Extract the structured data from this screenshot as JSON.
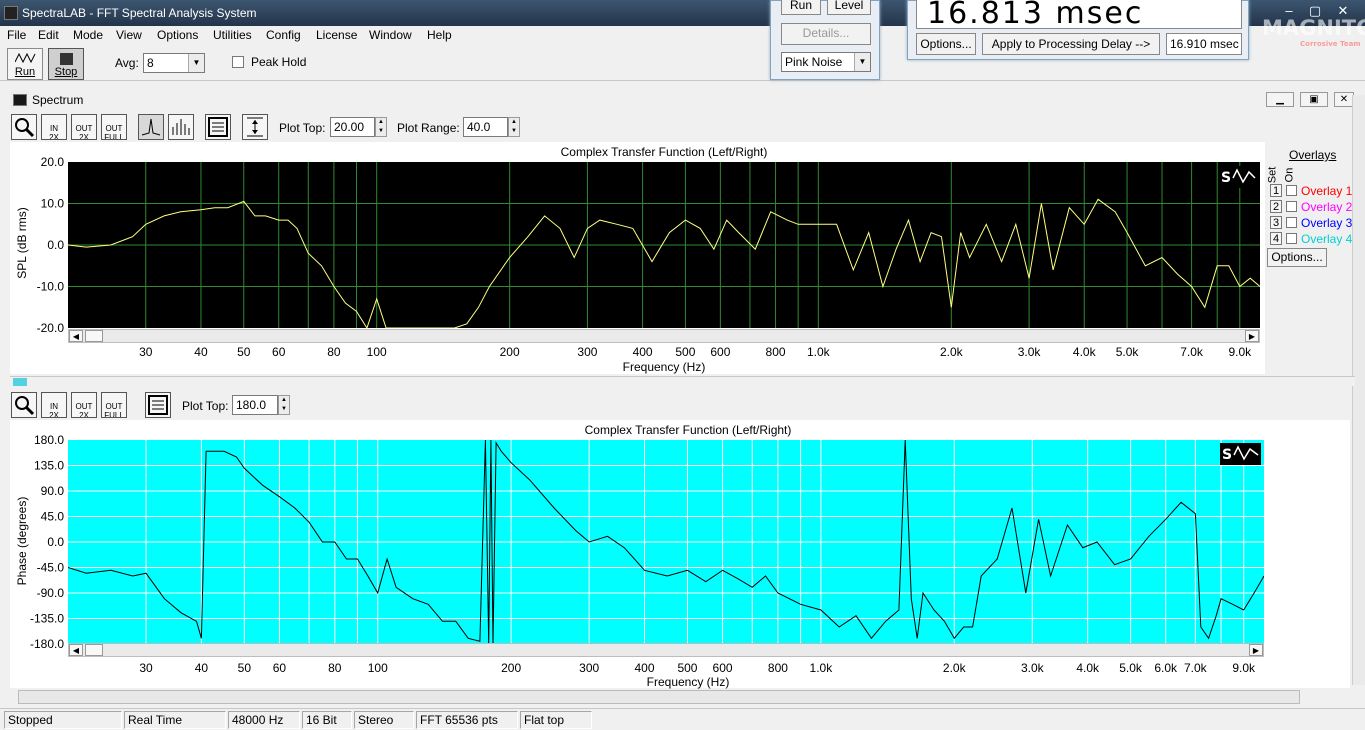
{
  "window": {
    "title": "SpectraLAB - FFT Spectral Analysis System"
  },
  "menu": [
    "File",
    "Edit",
    "Mode",
    "View",
    "Options",
    "Utilities",
    "Config",
    "License",
    "Window",
    "Help"
  ],
  "toolbar": {
    "run_label": "Run",
    "stop_label": "Stop",
    "avg_label": "Avg:",
    "avg_value": "8",
    "peak_hold_label": "Peak Hold"
  },
  "generator_panel": {
    "run_label": "Run",
    "level_label": "Level",
    "details_label": "Details...",
    "signal_value": "Pink Noise"
  },
  "delay_panel": {
    "delay_display": "16.813 msec",
    "options_label": "Options...",
    "apply_label": "Apply to Processing Delay -->",
    "delay_value": "16.910 msec"
  },
  "logo": {
    "main": "MAGNITOLA",
    "sub": "Corrosive Team"
  },
  "spectrum": {
    "window_title": "Spectrum",
    "plot_top_label": "Plot Top:",
    "plot_top_value": "20.00",
    "plot_range_label": "Plot Range:",
    "plot_range_value": "40.0",
    "overlays_title": "Overlays",
    "set_label": "Set",
    "on_label": "On",
    "overlays": [
      {
        "num": "1",
        "label": "Overlay 1",
        "color": "#ff0000"
      },
      {
        "num": "2",
        "label": "Overlay 2",
        "color": "#ff00ff"
      },
      {
        "num": "3",
        "label": "Overlay 3",
        "color": "#0000ff"
      },
      {
        "num": "4",
        "label": "Overlay 4",
        "color": "#00e0e0"
      }
    ],
    "options_label": "Options..."
  },
  "phase": {
    "plot_top_label": "Plot Top:",
    "plot_top_value": "180.0"
  },
  "status": [
    "Stopped",
    "Real Time",
    "48000 Hz",
    "16 Bit",
    "Stereo",
    "FFT 65536 pts",
    "Flat top"
  ],
  "chart_data": [
    {
      "type": "line",
      "title": "Complex Transfer Function (Left/Right)",
      "xlabel": "Frequency (Hz)",
      "ylabel": "SPL (dB rms)",
      "xscale": "log",
      "xlim": [
        20,
        10000
      ],
      "ylim": [
        -20,
        20
      ],
      "yticks": [
        "20.0",
        "10.0",
        "0.0",
        "-10.0",
        "-20.0"
      ],
      "xticks": [
        {
          "v": 30,
          "label": "30"
        },
        {
          "v": 40,
          "label": "40"
        },
        {
          "v": 50,
          "label": "50"
        },
        {
          "v": 60,
          "label": "60"
        },
        {
          "v": 80,
          "label": "80"
        },
        {
          "v": 100,
          "label": "100"
        },
        {
          "v": 200,
          "label": "200"
        },
        {
          "v": 300,
          "label": "300"
        },
        {
          "v": 400,
          "label": "400"
        },
        {
          "v": 500,
          "label": "500"
        },
        {
          "v": 600,
          "label": "600"
        },
        {
          "v": 800,
          "label": "800"
        },
        {
          "v": 1000,
          "label": "1.0k"
        },
        {
          "v": 2000,
          "label": "2.0k"
        },
        {
          "v": 3000,
          "label": "3.0k"
        },
        {
          "v": 4000,
          "label": "4.0k"
        },
        {
          "v": 5000,
          "label": "5.0k"
        },
        {
          "v": 7000,
          "label": "7.0k"
        },
        {
          "v": 9000,
          "label": "9.0k"
        }
      ],
      "background": "#000000",
      "grid_color": "#2e8b2e",
      "line_color": "#ffff80",
      "x": [
        20,
        22,
        25,
        28,
        30,
        33,
        36,
        40,
        43,
        46,
        50,
        53,
        56,
        60,
        63,
        66,
        70,
        75,
        80,
        85,
        90,
        95,
        100,
        105,
        110,
        120,
        130,
        140,
        150,
        160,
        170,
        180,
        200,
        220,
        240,
        260,
        280,
        300,
        320,
        350,
        380,
        420,
        460,
        500,
        540,
        580,
        620,
        660,
        720,
        780,
        850,
        900,
        1000,
        1100,
        1200,
        1300,
        1400,
        1500,
        1600,
        1700,
        1800,
        1900,
        2000,
        2100,
        2200,
        2400,
        2600,
        2800,
        3000,
        3200,
        3400,
        3700,
        4000,
        4300,
        4700,
        5000,
        5500,
        6000,
        6500,
        7000,
        7500,
        8000,
        8500,
        9000,
        9500,
        10000
      ],
      "y": [
        0,
        -0.5,
        0,
        2,
        5,
        7,
        8,
        8.5,
        9,
        9,
        10.5,
        7,
        7,
        6,
        6,
        4,
        -2,
        -5,
        -10,
        -14,
        -16,
        -20,
        -13,
        -20,
        -20,
        -20,
        -20,
        -20,
        -20,
        -19,
        -15,
        -10,
        -3,
        2,
        7,
        4,
        -3,
        4,
        6,
        5,
        4,
        -4,
        3,
        6,
        4,
        -1,
        6,
        3,
        -1,
        8,
        6,
        5,
        5,
        5,
        -6,
        3,
        -10,
        -1,
        6,
        -4,
        3,
        2,
        -15,
        3,
        -3,
        5,
        -4,
        5,
        -8,
        10,
        -6,
        9,
        5,
        11,
        8,
        3,
        -5,
        -3,
        -7,
        -10,
        -15,
        -5,
        -5,
        -10,
        -8,
        -10
      ]
    },
    {
      "type": "line",
      "title": "Complex Transfer Function (Left/Right)",
      "xlabel": "Frequency (Hz)",
      "ylabel": "Phase (degrees)",
      "xscale": "log",
      "xlim": [
        20,
        10000
      ],
      "ylim": [
        -180,
        180
      ],
      "yticks": [
        "180.0",
        "135.0",
        "90.0",
        "45.0",
        "0.0",
        "-45.0",
        "-90.0",
        "-135.0",
        "-180.0"
      ],
      "xticks": [
        {
          "v": 30,
          "label": "30"
        },
        {
          "v": 40,
          "label": "40"
        },
        {
          "v": 50,
          "label": "50"
        },
        {
          "v": 60,
          "label": "60"
        },
        {
          "v": 80,
          "label": "80"
        },
        {
          "v": 100,
          "label": "100"
        },
        {
          "v": 200,
          "label": "200"
        },
        {
          "v": 300,
          "label": "300"
        },
        {
          "v": 400,
          "label": "400"
        },
        {
          "v": 500,
          "label": "500"
        },
        {
          "v": 600,
          "label": "600"
        },
        {
          "v": 800,
          "label": "800"
        },
        {
          "v": 1000,
          "label": "1.0k"
        },
        {
          "v": 2000,
          "label": "2.0k"
        },
        {
          "v": 3000,
          "label": "3.0k"
        },
        {
          "v": 4000,
          "label": "4.0k"
        },
        {
          "v": 5000,
          "label": "5.0k"
        },
        {
          "v": 6000,
          "label": "6.0k"
        },
        {
          "v": 7000,
          "label": "7.0k"
        },
        {
          "v": 9000,
          "label": "9.0k"
        }
      ],
      "background": "#00ffff",
      "grid_color": "#ffffff",
      "line_color": "#000000",
      "x": [
        20,
        22,
        25,
        28,
        30,
        33,
        36,
        39,
        40,
        41,
        45,
        48,
        50,
        55,
        60,
        65,
        70,
        75,
        80,
        85,
        90,
        95,
        100,
        105,
        110,
        120,
        130,
        140,
        150,
        160,
        170,
        175,
        178,
        180,
        182,
        185,
        190,
        200,
        220,
        250,
        280,
        300,
        330,
        360,
        400,
        450,
        500,
        550,
        600,
        650,
        700,
        750,
        800,
        900,
        1000,
        1100,
        1200,
        1300,
        1400,
        1500,
        1550,
        1600,
        1650,
        1700,
        1800,
        1900,
        2000,
        2100,
        2200,
        2300,
        2500,
        2700,
        2900,
        3100,
        3300,
        3600,
        3900,
        4200,
        4600,
        5000,
        5500,
        6000,
        6500,
        7000,
        7200,
        7500,
        7800,
        8000,
        8500,
        9000,
        9500,
        10000
      ],
      "y": [
        -45,
        -55,
        -50,
        -60,
        -55,
        -100,
        -125,
        -140,
        -170,
        160,
        160,
        150,
        130,
        100,
        80,
        60,
        35,
        0,
        0,
        -30,
        -30,
        -60,
        -90,
        -30,
        -80,
        -100,
        -110,
        -140,
        -140,
        -170,
        -175,
        180,
        -180,
        180,
        -180,
        175,
        160,
        140,
        110,
        60,
        20,
        0,
        10,
        -10,
        -50,
        -60,
        -50,
        -70,
        -50,
        -65,
        -80,
        -60,
        -90,
        -110,
        -120,
        -150,
        -130,
        -170,
        -140,
        -120,
        180,
        -100,
        -170,
        -90,
        -120,
        -140,
        -170,
        -150,
        -150,
        -60,
        -30,
        60,
        -90,
        40,
        -60,
        30,
        -10,
        0,
        -40,
        -30,
        10,
        40,
        70,
        50,
        -150,
        -170,
        -130,
        -100,
        -110,
        -120,
        -90,
        -60
      ]
    }
  ]
}
